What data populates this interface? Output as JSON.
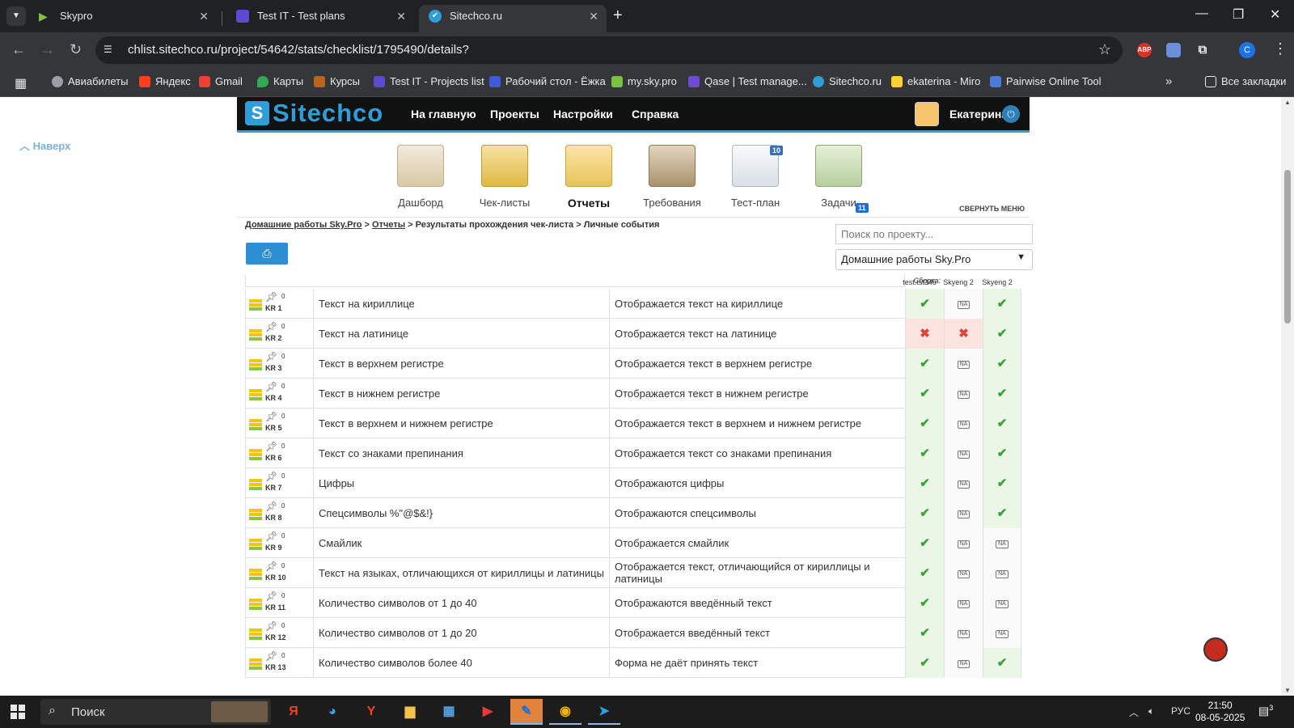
{
  "browser": {
    "tabs": [
      {
        "title": "Skypro",
        "active": false
      },
      {
        "title": "Test IT - Test plans",
        "active": false
      },
      {
        "title": "Sitechco.ru",
        "active": true
      }
    ],
    "url": "chlist.sitechco.ru/project/54642/stats/checklist/1795490/details?",
    "profile_initial": "C",
    "ext_abp": "ABP",
    "bookmarks": [
      {
        "label": "Авиабилеты",
        "color": "#9aa0a6"
      },
      {
        "label": "Яндекс",
        "color": "#fc3f1d"
      },
      {
        "label": "Gmail",
        "color": "#ea4335"
      },
      {
        "label": "Карты",
        "color": "#34a853"
      },
      {
        "label": "Курсы",
        "color": "#b5651d"
      },
      {
        "label": "Test IT - Projects list",
        "color": "#5b4ccf"
      },
      {
        "label": "Рабочий стол - Ёжка",
        "color": "#3b5bdb"
      },
      {
        "label": "my.sky.pro",
        "color": "#7cc242"
      },
      {
        "label": "Qase | Test manage...",
        "color": "#6c4bd8"
      },
      {
        "label": "Sitechco.ru",
        "color": "#2d9ed8"
      },
      {
        "label": "ekaterina - Miro",
        "color": "#ffd02f"
      },
      {
        "label": "Pairwise Online Tool",
        "color": "#4a7bd8"
      }
    ],
    "all_bookmarks": "Все закладки"
  },
  "page": {
    "back_to_top": "Наверх",
    "logo": "Sitechco",
    "nav": [
      "На главную",
      "Проекты",
      "Настройки",
      "Справка"
    ],
    "user": "Екатерина",
    "menu": [
      {
        "label": "Дашборд",
        "icon": "dashboard-icon",
        "active": false
      },
      {
        "label": "Чек-листы",
        "icon": "checklists-icon",
        "active": false
      },
      {
        "label": "Отчеты",
        "icon": "reports-icon",
        "active": true
      },
      {
        "label": "Требования",
        "icon": "requirements-icon",
        "active": false
      },
      {
        "label": "Тест-план",
        "icon": "testplan-icon",
        "active": false,
        "badge": "10"
      },
      {
        "label": "Задачи",
        "icon": "tasks-icon",
        "active": false,
        "badge": "11"
      }
    ],
    "collapse_menu": "СВЕРНУТЬ МЕНЮ",
    "breadcrumb": {
      "home": "Домашние работы Sky.Pro",
      "reports": "Отчеты",
      "rest": "> Результаты прохождения чек-листа > Личные события"
    },
    "search_placeholder": "Поиск по проекту...",
    "project_selected": "Домашние работы Sky.Pro",
    "columns": {
      "build_label": "Сборка:",
      "run1": "test.tst345",
      "run2": "Skyeng 2",
      "run3": "Skyeng 2"
    },
    "rows": [
      {
        "id": "KR 1",
        "count": "0",
        "step": "Текст на кириллице",
        "expected": "Отображается текст на кириллице",
        "r": [
          "pass",
          "na",
          "pass"
        ]
      },
      {
        "id": "KR 2",
        "count": "0",
        "step": "Текст на латинице",
        "expected": "Отображается текст на латинице",
        "r": [
          "fail",
          "fail",
          "pass"
        ]
      },
      {
        "id": "KR 3",
        "count": "0",
        "step": "Текст в верхнем регистре",
        "expected": "Отображается текст в верхнем регистре",
        "r": [
          "pass",
          "na",
          "pass"
        ]
      },
      {
        "id": "KR 4",
        "count": "0",
        "step": "Текст в нижнем регистре",
        "expected": "Отображается текст в нижнем регистре",
        "r": [
          "pass",
          "na",
          "pass"
        ]
      },
      {
        "id": "KR 5",
        "count": "0",
        "step": "Текст в верхнем и нижнем регистре",
        "expected": "Отображается текст в верхнем и нижнем регистре",
        "r": [
          "pass",
          "na",
          "pass"
        ]
      },
      {
        "id": "KR 6",
        "count": "0",
        "step": "Текст со знаками препинания",
        "expected": "Отображается текст со знаками препинания",
        "r": [
          "pass",
          "na",
          "pass"
        ]
      },
      {
        "id": "KR 7",
        "count": "0",
        "step": "Цифры",
        "expected": "Отображаются цифры",
        "r": [
          "pass",
          "na",
          "pass"
        ]
      },
      {
        "id": "KR 8",
        "count": "0",
        "step": "Спецсимволы %\"@$&!}",
        "expected": "Отображаются спецсимволы",
        "r": [
          "pass",
          "na",
          "pass"
        ]
      },
      {
        "id": "KR 9",
        "count": "0",
        "step": "Смайлик",
        "expected": "Отображается смайлик",
        "r": [
          "pass",
          "na",
          "na"
        ]
      },
      {
        "id": "KR 10",
        "count": "0",
        "step": "Текст на языках, отличающихся от кириллицы и латиницы",
        "expected": "Отображается текст, отличающийся от кириллицы и латиницы",
        "r": [
          "pass",
          "na",
          "na"
        ]
      },
      {
        "id": "KR 11",
        "count": "0",
        "step": "Количество символов от 1 до 40",
        "expected": "Отображаются введённый текст",
        "r": [
          "pass",
          "na",
          "na"
        ]
      },
      {
        "id": "KR 12",
        "count": "0",
        "step": "Количество символов от 1 до 20",
        "expected": "Отображается введённый текст",
        "r": [
          "pass",
          "na",
          "na"
        ]
      },
      {
        "id": "KR 13",
        "count": "0",
        "step": "Количество символов более 40",
        "expected": "Форма не даёт принять текст",
        "r": [
          "pass",
          "na",
          "pass"
        ]
      }
    ]
  },
  "taskbar": {
    "search": "Поиск",
    "lang": "РУС",
    "time": "21:50",
    "date": "08-05-2025",
    "notifications": "3"
  }
}
